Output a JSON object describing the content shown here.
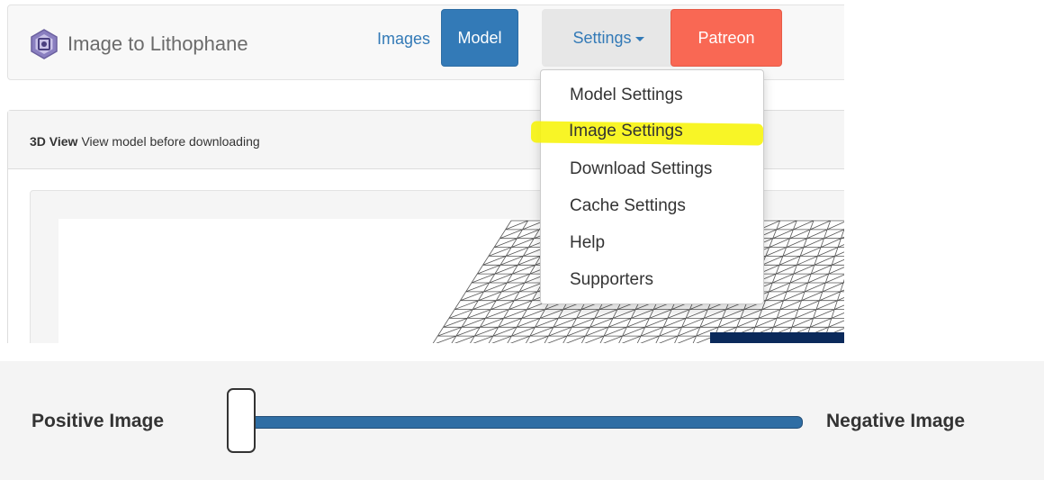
{
  "navbar": {
    "brand": "Image to Lithophane",
    "links": {
      "images": "Images",
      "model": "Model",
      "settings": "Settings",
      "patreon": "Patreon"
    }
  },
  "settings_menu": {
    "items": [
      "Model Settings",
      "Image Settings",
      "Download Settings",
      "Cache Settings",
      "Help",
      "Supporters"
    ],
    "highlighted_item": "Image Settings"
  },
  "panel": {
    "title_bold": "3D View",
    "title_rest": "View model before downloading"
  },
  "image_type_slider": {
    "left_label": "Positive Image",
    "right_label": "Negative Image",
    "value": 0
  },
  "colors": {
    "primary": "#337ab7",
    "patreon": "#f96854",
    "highlighter": "#f7f300",
    "slider_track": "#2f6ea4",
    "preview_dark": "#0b2a5b"
  },
  "icons": [
    "lithophane-logo-icon",
    "caret-down-icon"
  ]
}
